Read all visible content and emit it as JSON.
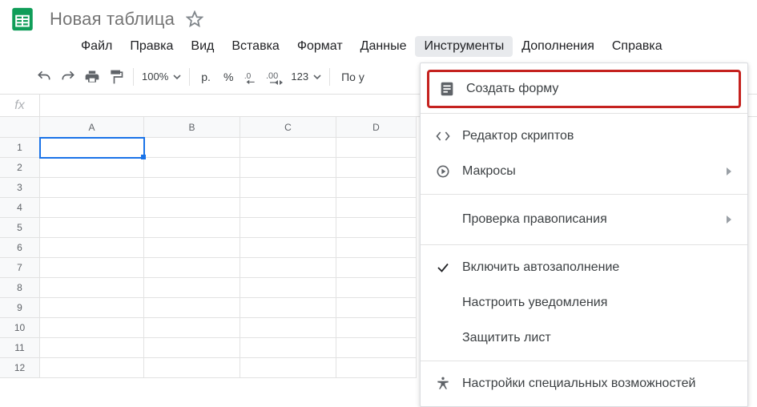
{
  "title": {
    "doc_name": "Новая таблица"
  },
  "menubar": {
    "file": "Файл",
    "edit": "Правка",
    "view": "Вид",
    "insert": "Вставка",
    "format": "Формат",
    "data": "Данные",
    "tools": "Инструменты",
    "addons": "Дополнения",
    "help": "Справка"
  },
  "toolbar": {
    "zoom": "100%",
    "currency": "р.",
    "percent": "%",
    "dec_dec": ".0",
    "inc_dec": ".00",
    "numfmt": "123",
    "font_label": "По у"
  },
  "fx": {
    "value": ""
  },
  "grid": {
    "columns": [
      "A",
      "B",
      "C",
      "D"
    ],
    "rows": [
      "1",
      "2",
      "3",
      "4",
      "5",
      "6",
      "7",
      "8",
      "9",
      "10",
      "11",
      "12"
    ]
  },
  "tools_menu": {
    "create_form": "Создать форму",
    "script_editor": "Редактор скриптов",
    "macros": "Макросы",
    "spellcheck": "Проверка правописания",
    "autocomplete": "Включить автозаполнение",
    "notifications": "Настроить уведомления",
    "protect": "Защитить лист",
    "accessibility": "Настройки специальных возможностей"
  }
}
